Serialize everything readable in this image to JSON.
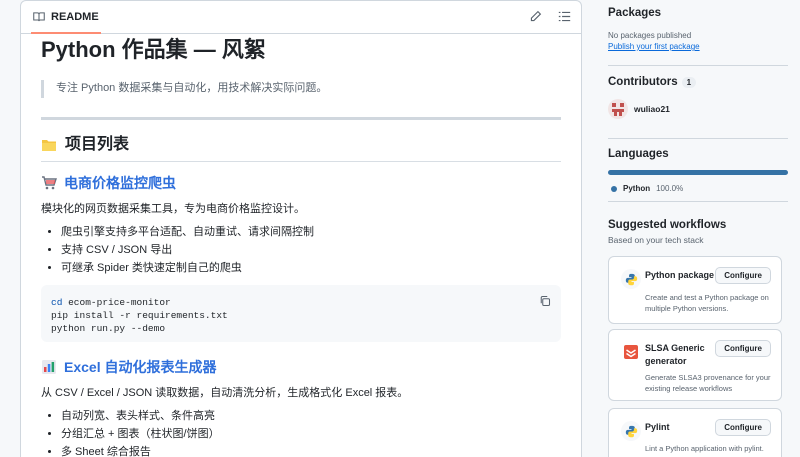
{
  "readme": {
    "tab_label": "README",
    "title": "Python 作品集 — 风絮",
    "quote": "专注 Python 数据采集与自动化，用技术解决实际问题。",
    "projects_heading": "项目列表",
    "project1": {
      "title": "电商价格监控爬虫",
      "desc": "模块化的网页数据采集工具，专为电商价格监控设计。",
      "bullets": [
        "爬虫引擎支持多平台适配、自动重试、请求间隔控制",
        "支持 CSV / JSON 导出",
        "可继承 Spider 类快速定制自己的爬虫"
      ],
      "code": {
        "line1_kw": "cd",
        "line1_rest": " ecom-price-monitor",
        "line2": "pip install -r requirements.txt",
        "line3": "python run.py --demo"
      }
    },
    "project2": {
      "title": "Excel 自动化报表生成器",
      "desc": "从 CSV / Excel / JSON 读取数据，自动清洗分析，生成格式化 Excel 报表。",
      "bullets": [
        "自动列宽、表头样式、条件高亮",
        "分组汇总 + 图表（柱状图/饼图）",
        "多 Sheet 综合报告"
      ]
    }
  },
  "sidebar": {
    "packages": {
      "heading": "Packages",
      "none_text": "No packages published",
      "link": "Publish your first package"
    },
    "contributors": {
      "heading": "Contributors",
      "count": "1",
      "user": "wuliao21"
    },
    "languages": {
      "heading": "Languages",
      "lang": "Python",
      "pct": "100.0%",
      "fraction": 1.0,
      "color": "#3572a5"
    },
    "workflows": {
      "heading": "Suggested workflows",
      "sub": "Based on your tech stack",
      "items": [
        {
          "title": "Python package",
          "button": "Configure",
          "desc": "Create and test a Python package on multiple Python versions."
        },
        {
          "title": "SLSA Generic generator",
          "button": "Configure",
          "desc": "Generate SLSA3 provenance for your existing release workflows"
        },
        {
          "title": "Pylint",
          "button": "Configure",
          "desc": "Lint a Python application with pylint."
        }
      ]
    }
  }
}
